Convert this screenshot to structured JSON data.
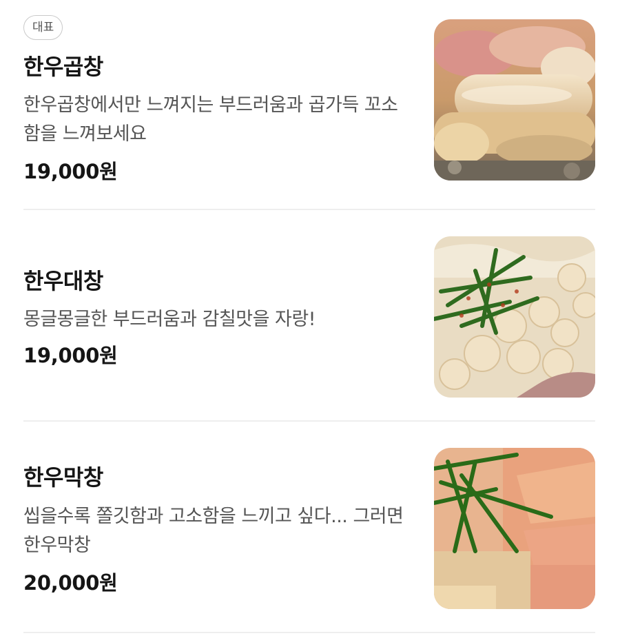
{
  "menu": {
    "items": [
      {
        "badge": "대표",
        "name": "한우곱창",
        "description": "한우곱창에서만 느껴지는 부드러움과 곱가득 꼬소함을 느껴보세요",
        "price": "19,000원",
        "image": "grilled-gopchang-photo"
      },
      {
        "name": "한우대창",
        "description": "몽글몽글한 부드러움과 감칠맛을 자랑!",
        "price": "19,000원",
        "image": "daechang-chives-photo"
      },
      {
        "name": "한우막창",
        "description": "씹을수록 쫄깃함과 고소함을 느끼고 싶다... 그러면 한우막창",
        "price": "20,000원",
        "image": "makchang-chives-photo"
      }
    ]
  }
}
